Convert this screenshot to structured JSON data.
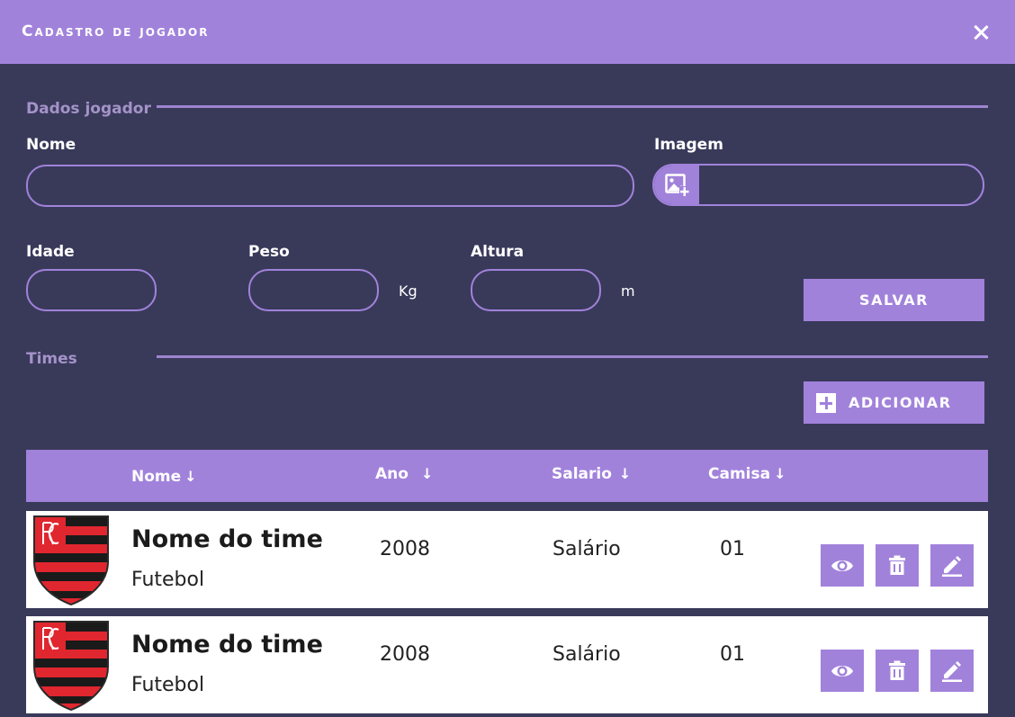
{
  "header": {
    "title": "Cadastro de jogador"
  },
  "sections": {
    "player": "Dados jogador",
    "teams": "Times"
  },
  "form": {
    "name_label": "Nome",
    "name_value": "",
    "image_label": "Imagem",
    "image_value": "",
    "age_label": "Idade",
    "age_value": "",
    "weight_label": "Peso",
    "weight_value": "",
    "weight_unit": "Kg",
    "height_label": "Altura",
    "height_value": "",
    "height_unit": "m",
    "save_label": "SALVAR"
  },
  "add_button": {
    "label": "ADICIONAR"
  },
  "table": {
    "columns": [
      {
        "label": "Nome",
        "arrow": "↓"
      },
      {
        "label": "Ano",
        "arrow": "↓"
      },
      {
        "label": "Salario",
        "arrow": "↓"
      },
      {
        "label": "Camisa",
        "arrow": "↓"
      }
    ],
    "rows": [
      {
        "name": "Nome do time",
        "sport": "Futebol",
        "year": "2008",
        "salary": "Salário",
        "shirt": "01"
      },
      {
        "name": "Nome do time",
        "sport": "Futebol",
        "year": "2008",
        "salary": "Salário",
        "shirt": "01"
      }
    ]
  },
  "colors": {
    "accent": "#a182db",
    "background": "#393a5a",
    "crest_red": "#e0262f",
    "crest_black": "#1a1a1a"
  },
  "icons": {
    "close": "close-icon",
    "image_add": "add-image-icon",
    "plus": "plus-icon",
    "view": "eye-icon",
    "delete": "trash-icon",
    "edit": "pencil-icon",
    "crest": "flamengo-crest-icon"
  }
}
